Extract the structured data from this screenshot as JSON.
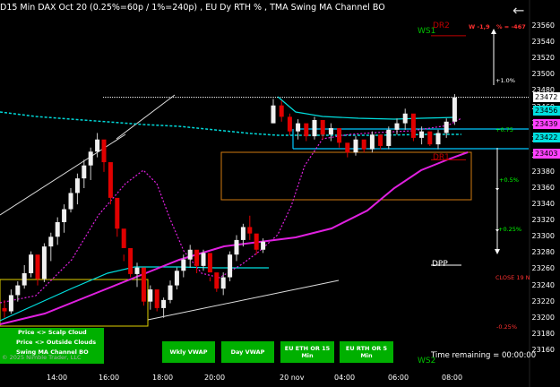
{
  "header": {
    "title": "D15 Min DAX Oct 20 (0.25%=60p / 1%=240p) , EU Dy RTH % , TMA Swing MA Channel BO",
    "back_icon": "back-arrow-icon"
  },
  "chart_data": {
    "type": "candlestick",
    "ylim": [
      23150,
      23570
    ],
    "y_ticks": [
      23160,
      23180,
      23200,
      23220,
      23240,
      23260,
      23280,
      23300,
      23320,
      23340,
      23360,
      23380,
      23400,
      23420,
      23440,
      23460,
      23480,
      23500,
      23520,
      23540,
      23560
    ],
    "x_ticks": [
      "14:00",
      "16:00",
      "18:00",
      "20:00",
      "20 nov",
      "04:00",
      "06:00",
      "08:00"
    ],
    "price_tags": [
      {
        "value": "23472",
        "color": "#ffffff",
        "text_color": "#000000"
      },
      {
        "value": "23456",
        "color": "#00e0e0",
        "text_color": "#000000"
      },
      {
        "value": "23439",
        "color": "#ff40ff",
        "text_color": "#000000"
      },
      {
        "value": "23422",
        "color": "#00e0e0",
        "text_color": "#000000"
      },
      {
        "value": "23403",
        "color": "#ff40ff",
        "text_color": "#000000"
      }
    ],
    "levels": [
      {
        "label": "WS1",
        "value": 23545,
        "color": "#00c000"
      },
      {
        "label": "DR2",
        "value": 23548,
        "color": "#c00000"
      },
      {
        "label": "DR1",
        "value": 23395,
        "color": "#c00000"
      },
      {
        "label": "DPP",
        "value": 23265,
        "color": "#ffffff"
      },
      {
        "label": "WS2",
        "value": 23158,
        "color": "#00c000"
      }
    ],
    "annotations": [
      {
        "text": "W -1,9",
        "color": "#ff3030"
      },
      {
        "text": "% = -467",
        "color": "#ff3030"
      },
      {
        "text": "+1.0%",
        "color": "#ffffff"
      },
      {
        "text": "+0.75",
        "color": "#00ff00"
      },
      {
        "text": "+0.5%",
        "color": "#00ff00"
      },
      {
        "text": "+0.25%",
        "color": "#00ff00"
      },
      {
        "text": "-0.25%",
        "color": "#ff3030"
      },
      {
        "text": "CLOSE 19 N",
        "color": "#ff3030"
      }
    ],
    "candles": [
      [
        23212,
        23222,
        23200,
        23208
      ],
      [
        23208,
        23235,
        23205,
        23228
      ],
      [
        23228,
        23245,
        23220,
        23240
      ],
      [
        23240,
        23265,
        23236,
        23255
      ],
      [
        23255,
        23282,
        23250,
        23278
      ],
      [
        23278,
        23270,
        23240,
        23248
      ],
      [
        23248,
        23292,
        23244,
        23288
      ],
      [
        23288,
        23305,
        23270,
        23300
      ],
      [
        23300,
        23324,
        23290,
        23318
      ],
      [
        23318,
        23340,
        23305,
        23334
      ],
      [
        23334,
        23360,
        23330,
        23354
      ],
      [
        23354,
        23378,
        23340,
        23372
      ],
      [
        23372,
        23395,
        23360,
        23388
      ],
      [
        23388,
        23410,
        23370,
        23405
      ],
      [
        23405,
        23428,
        23398,
        23420
      ],
      [
        23420,
        23400,
        23380,
        23392
      ],
      [
        23392,
        23362,
        23340,
        23348
      ],
      [
        23348,
        23326,
        23300,
        23310
      ],
      [
        23310,
        23278,
        23270,
        23286
      ],
      [
        23286,
        23260,
        23250,
        23254
      ],
      [
        23254,
        23268,
        23238,
        23262
      ],
      [
        23262,
        23226,
        23215,
        23220
      ],
      [
        23220,
        23240,
        23210,
        23235
      ],
      [
        23235,
        23214,
        23208,
        23212
      ],
      [
        23212,
        23225,
        23200,
        23222
      ],
      [
        23222,
        23246,
        23218,
        23240
      ],
      [
        23240,
        23262,
        23235,
        23258
      ],
      [
        23258,
        23278,
        23250,
        23272
      ],
      [
        23272,
        23290,
        23262,
        23284
      ],
      [
        23284,
        23270,
        23255,
        23264
      ],
      [
        23264,
        23284,
        23258,
        23280
      ],
      [
        23280,
        23250,
        23245,
        23256
      ],
      [
        23256,
        23242,
        23232,
        23236
      ],
      [
        23236,
        23256,
        23228,
        23250
      ],
      [
        23250,
        23282,
        23245,
        23278
      ],
      [
        23278,
        23302,
        23270,
        23296
      ],
      [
        23296,
        23316,
        23288,
        23312
      ],
      [
        23312,
        23326,
        23296,
        23304
      ],
      [
        23304,
        23290,
        23278,
        23284
      ],
      [
        23284,
        23298,
        23280,
        23294
      ],
      [
        23440,
        23470,
        23440,
        23462
      ],
      [
        23462,
        23468,
        23442,
        23448
      ],
      [
        23448,
        23452,
        23425,
        23430
      ],
      [
        23430,
        23445,
        23420,
        23440
      ],
      [
        23440,
        23432,
        23418,
        23424
      ],
      [
        23424,
        23448,
        23420,
        23444
      ],
      [
        23444,
        23436,
        23420,
        23426
      ],
      [
        23426,
        23440,
        23418,
        23434
      ],
      [
        23434,
        23428,
        23410,
        23416
      ],
      [
        23416,
        23412,
        23398,
        23404
      ],
      [
        23404,
        23424,
        23400,
        23420
      ],
      [
        23420,
        23412,
        23404,
        23408
      ],
      [
        23408,
        23430,
        23404,
        23426
      ],
      [
        23426,
        23420,
        23408,
        23412
      ],
      [
        23412,
        23436,
        23408,
        23432
      ],
      [
        23432,
        23446,
        23426,
        23440
      ],
      [
        23440,
        23458,
        23432,
        23452
      ],
      [
        23452,
        23440,
        23418,
        23422
      ],
      [
        23422,
        23436,
        23414,
        23430
      ],
      [
        23430,
        23418,
        23412,
        23414
      ],
      [
        23414,
        23432,
        23408,
        23428
      ],
      [
        23428,
        23446,
        23422,
        23442
      ],
      [
        23442,
        23476,
        23438,
        23472
      ]
    ]
  },
  "legend": {
    "line1": "Price <> Scalp Cloud",
    "line2": "Price <> Outside Clouds",
    "line3": "Swing MA Channel BO",
    "watermark": "© 2025 Nimble Trader, LLC"
  },
  "buttons": {
    "wkly_vwap": "Wkly VWAP",
    "day_vwap": "Day VWAP",
    "eu_eth": "EU ETH OR 15 Min",
    "eu_rth": "EU RTH OR 5 Min"
  },
  "footer": {
    "time_remaining": "Time remaining = 00:00:00"
  }
}
